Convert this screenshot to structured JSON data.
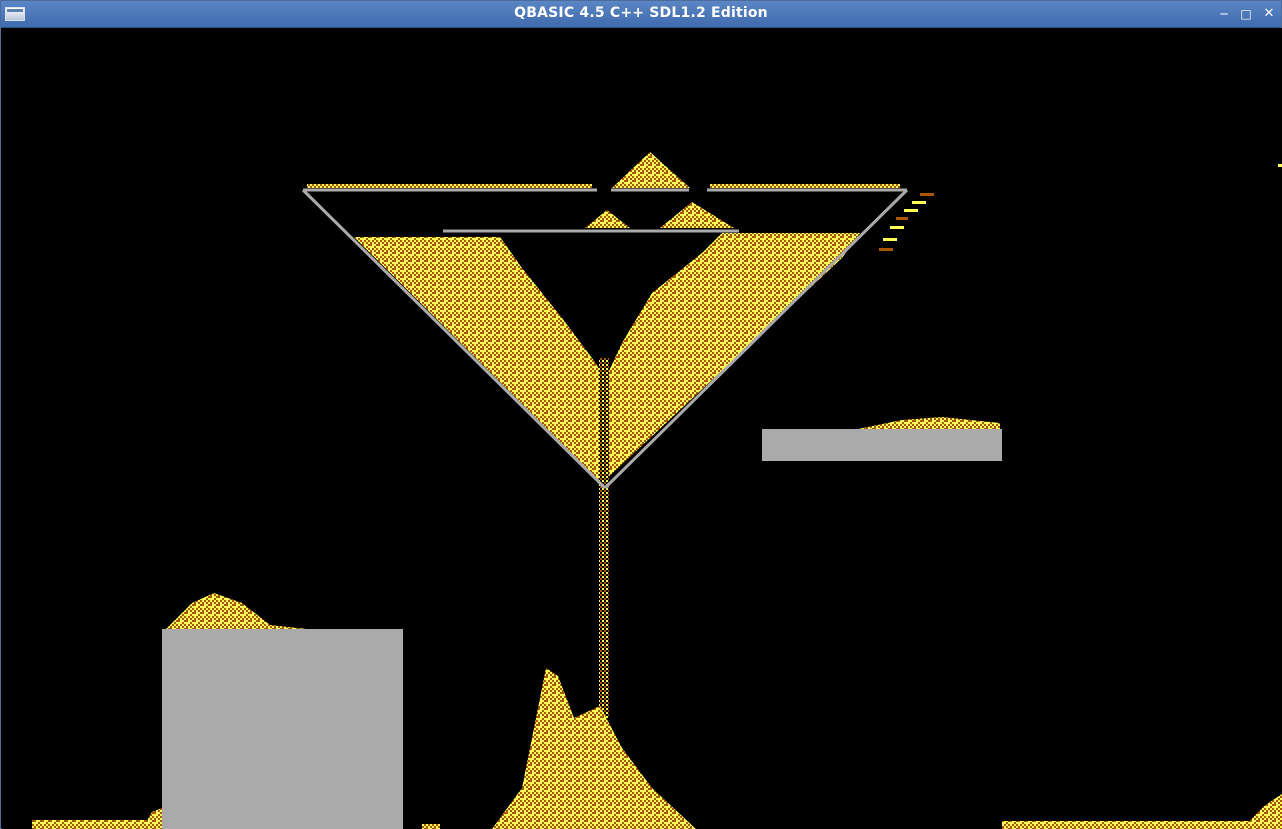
{
  "window": {
    "title": "QBASIC 4.5 C++ SDL1.2 Edition",
    "buttons": {
      "minimize_icon": "minimize-icon",
      "maximize_icon": "maximize-icon",
      "close_icon": "close-icon"
    }
  },
  "colors": {
    "background": "#000000",
    "sand_light": "#ffff55",
    "sand_dark": "#aa5500",
    "wall": "#aaaaaa",
    "titlebar": "#4a77b8"
  }
}
